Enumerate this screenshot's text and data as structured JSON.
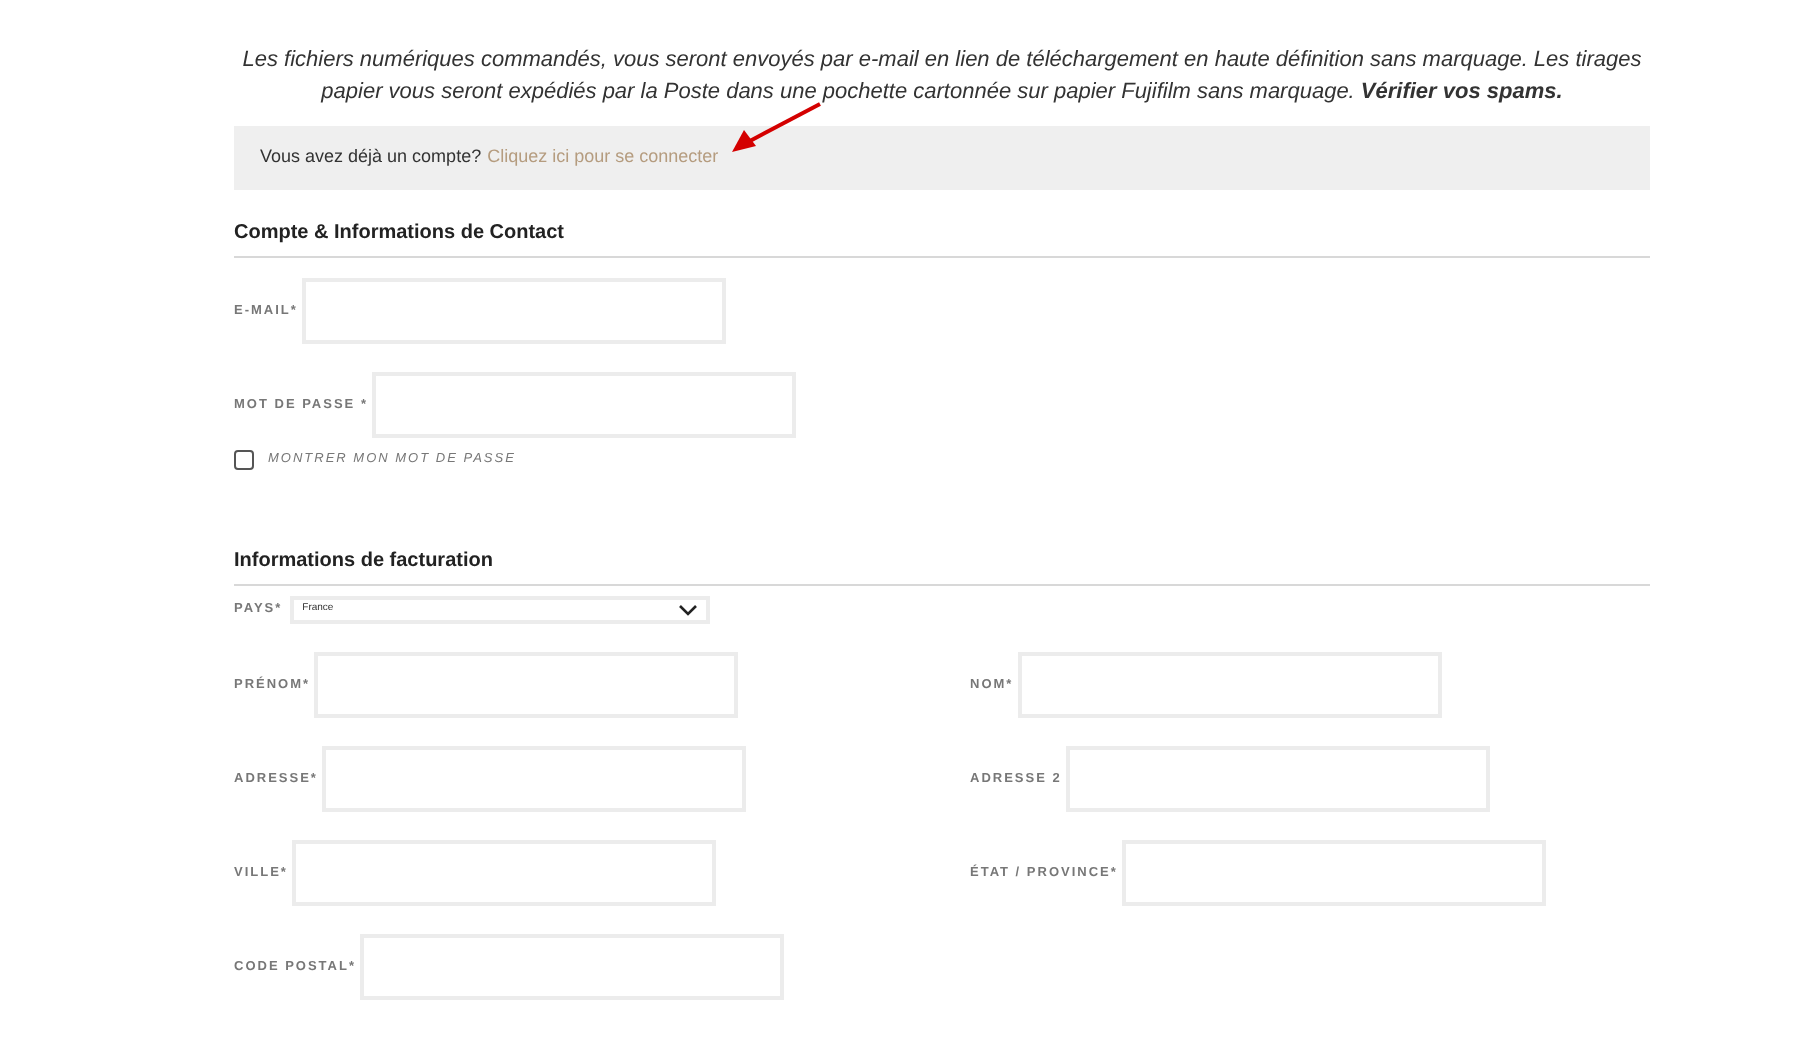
{
  "intro": "Les fichiers numériques commandés, vous seront envoyés par e-mail en lien de téléchargement en haute définition sans marquage. Les tirages papier vous seront expédiés par la Poste dans une pochette cartonnée sur papier Fujifilm sans marquage. **Vérifier vos spams.**",
  "login": {
    "prompt": "Vous avez déjà un compte?",
    "link": "Cliquez ici pour se connecter"
  },
  "account": {
    "title": "Compte & Informations de Contact",
    "fields": [
      {
        "label": "E-MAIL*"
      },
      {
        "label": "MOT DE PASSE *"
      }
    ],
    "show_password": {
      "label": "MONTRER MON MOT DE PASSE",
      "checked": false
    }
  },
  "billing": {
    "title": "Informations de facturation",
    "country": {
      "label": "PAYS*",
      "value": "France"
    },
    "left": [
      {
        "label": "PRÉNOM*"
      },
      {
        "label": "ADRESSE*"
      },
      {
        "label": "VILLE*"
      },
      {
        "label": "CODE POSTAL*"
      }
    ],
    "right": [
      {
        "label": "NOM*"
      },
      {
        "label": "ADRESSE 2"
      },
      {
        "label": "ÉTAT / PROVINCE*"
      }
    ]
  }
}
